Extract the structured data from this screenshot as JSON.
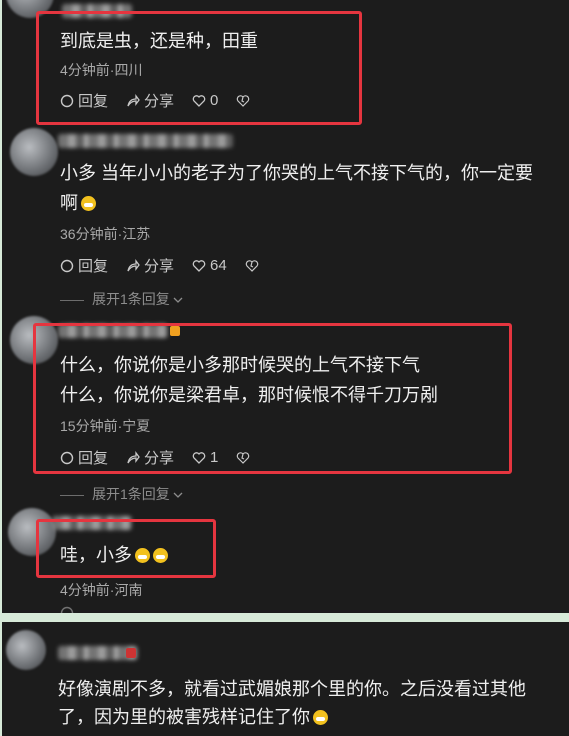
{
  "comments": [
    {
      "text": "到底是虫，还是种，田重",
      "meta": "4分钟前·四川",
      "reply": "回复",
      "share": "分享",
      "likes": "0"
    },
    {
      "text_line1": "小多 当年小小的老子为了你哭的上气不接下气的，你一定要",
      "text_line2": "啊",
      "meta": "36分钟前·江苏",
      "reply": "回复",
      "share": "分享",
      "likes": "64",
      "expand": "展开1条回复"
    },
    {
      "text_line1": "什么，你说你是小多那时候哭的上气不接下气",
      "text_line2": "什么，你说你是梁君卓，那时候恨不得千刀万剐",
      "meta": "15分钟前·宁夏",
      "reply": "回复",
      "share": "分享",
      "likes": "1",
      "expand": "展开1条回复"
    },
    {
      "text": "哇，小多",
      "meta": "4分钟前·河南"
    },
    {
      "text_line1": "好像演剧不多，就看过武媚娘那个里的你。之后没看过其他",
      "text_line2": "了，因为里的被害残样记住了你"
    }
  ]
}
